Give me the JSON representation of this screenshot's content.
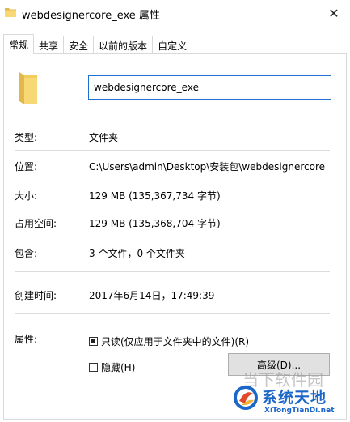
{
  "window": {
    "title": "webdesignercore_exe 属性",
    "close_glyph": "✕"
  },
  "tabs": [
    {
      "label": "常规",
      "active": true
    },
    {
      "label": "共享",
      "active": false
    },
    {
      "label": "安全",
      "active": false
    },
    {
      "label": "以前的版本",
      "active": false
    },
    {
      "label": "自定义",
      "active": false
    }
  ],
  "general": {
    "name_value": "webdesignercore_exe",
    "type": {
      "label": "类型:",
      "value": "文件夹"
    },
    "location": {
      "label": "位置:",
      "value": "C:\\Users\\admin\\Desktop\\安装包\\webdesignercore"
    },
    "size": {
      "label": "大小:",
      "value": "129 MB (135,367,734 字节)"
    },
    "size_on_disk": {
      "label": "占用空间:",
      "value": "129 MB (135,368,704 字节)"
    },
    "contains": {
      "label": "包含:",
      "value": "3 个文件，0 个文件夹"
    },
    "created": {
      "label": "创建时间:",
      "value": "2017年6月14日，17:49:39"
    },
    "attributes": {
      "label": "属性:",
      "readonly_label": "只读(仅应用于文件夹中的文件)(R)",
      "readonly_state": "indeterminate",
      "hidden_label": "隐藏(H)",
      "hidden_state": "unchecked",
      "advanced_button": "高级(D)..."
    }
  },
  "watermark": {
    "top_text": "当下软件园",
    "brand": "系统天地",
    "url": "XiTongTianDi.net"
  },
  "colors": {
    "folder_yellow": "#f8d775",
    "folder_dark": "#e3b84a",
    "input_border": "#1e6fd0",
    "brand_blue": "#1b66c9"
  }
}
